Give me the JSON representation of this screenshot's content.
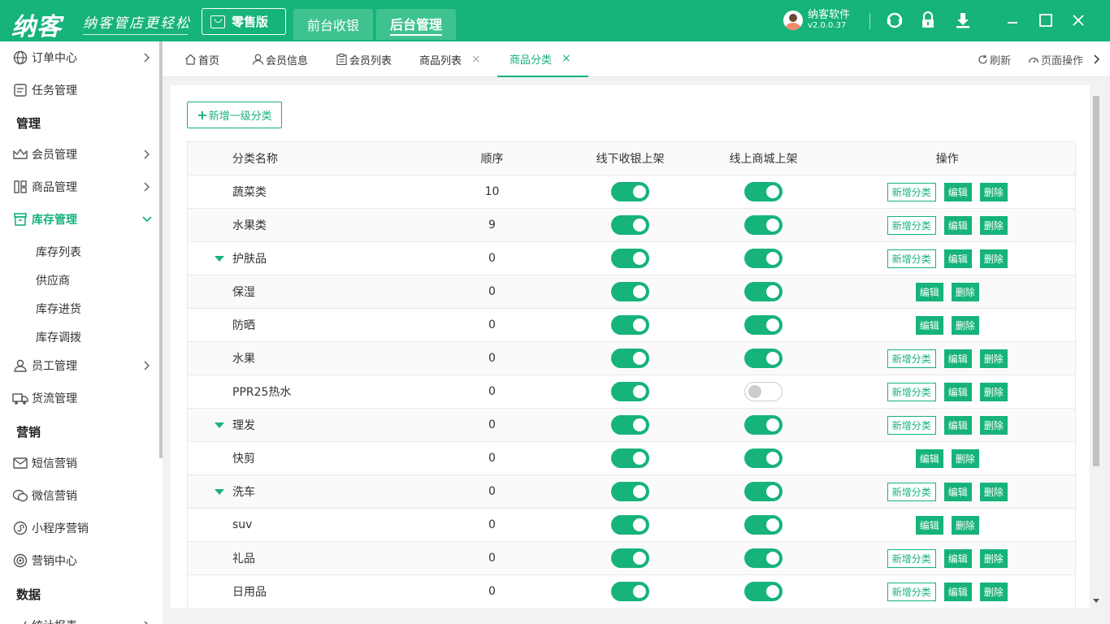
{
  "brand": {
    "logo": "纳客",
    "slogan": "纳客管店更轻松",
    "accent": "#16b37a"
  },
  "header": {
    "edition_label": "零售版",
    "tabs": [
      "前台收银",
      "后台管理"
    ],
    "user_name": "纳客软件",
    "version": "v2.0.0.37"
  },
  "sidebar": {
    "items": [
      {
        "label": "订单中心",
        "icon": "globe-icon",
        "has_arrow": true
      },
      {
        "label": "任务管理",
        "icon": "task-icon",
        "has_arrow": false
      },
      {
        "label": "会员管理",
        "icon": "crown-icon",
        "has_arrow": true
      },
      {
        "label": "商品管理",
        "icon": "goods-icon",
        "has_arrow": true
      },
      {
        "label": "库存管理",
        "icon": "inventory-icon",
        "has_arrow": true
      },
      {
        "label": "员工管理",
        "icon": "user-icon",
        "has_arrow": true
      },
      {
        "label": "货流管理",
        "icon": "truck-icon",
        "has_arrow": false
      },
      {
        "label": "短信营销",
        "icon": "mail-icon",
        "has_arrow": false
      },
      {
        "label": "微信营销",
        "icon": "wechat-icon",
        "has_arrow": false
      },
      {
        "label": "小程序营销",
        "icon": "miniprogram-icon",
        "has_arrow": false
      },
      {
        "label": "营销中心",
        "icon": "target-icon",
        "has_arrow": false
      },
      {
        "label": "统计报表",
        "icon": "chart-icon",
        "has_arrow": true
      }
    ],
    "groups": [
      "管理",
      "营销",
      "数据"
    ],
    "sub_items": [
      "库存列表",
      "供应商",
      "库存进货",
      "库存调拨"
    ]
  },
  "tabbar": {
    "tabs": [
      {
        "label": "首页",
        "icon": "home-icon"
      },
      {
        "label": "会员信息",
        "icon": "person-icon"
      },
      {
        "label": "会员列表",
        "icon": "clipboard-icon"
      },
      {
        "label": "商品列表",
        "closable": true
      },
      {
        "label": "商品分类",
        "closable": true,
        "active": true
      }
    ],
    "close_glyph": "×",
    "refresh": "刷新",
    "page_ops": "页面操作"
  },
  "toolbar": {
    "add_level1": "新增一级分类"
  },
  "table": {
    "headers": [
      "分类名称",
      "顺序",
      "线下收银上架",
      "线上商城上架",
      "操作"
    ],
    "op_labels": {
      "add": "新增分类",
      "edit": "编辑",
      "delete": "删除"
    },
    "rows": [
      {
        "name": "蔬菜类",
        "order": "10",
        "offline": true,
        "online": true,
        "can_add": true,
        "caret": false
      },
      {
        "name": "水果类",
        "order": "9",
        "offline": true,
        "online": true,
        "can_add": true,
        "caret": false
      },
      {
        "name": "护肤品",
        "order": "0",
        "offline": true,
        "online": true,
        "can_add": true,
        "caret": true
      },
      {
        "name": "保湿",
        "order": "0",
        "offline": true,
        "online": true,
        "can_add": false,
        "caret": false
      },
      {
        "name": "防晒",
        "order": "0",
        "offline": true,
        "online": true,
        "can_add": false,
        "caret": false
      },
      {
        "name": "水果",
        "order": "0",
        "offline": true,
        "online": true,
        "can_add": true,
        "caret": false
      },
      {
        "name": "PPR25热水",
        "order": "0",
        "offline": true,
        "online": false,
        "can_add": true,
        "caret": false
      },
      {
        "name": "理发",
        "order": "0",
        "offline": true,
        "online": true,
        "can_add": true,
        "caret": true
      },
      {
        "name": "快剪",
        "order": "0",
        "offline": true,
        "online": true,
        "can_add": false,
        "caret": false
      },
      {
        "name": "洗车",
        "order": "0",
        "offline": true,
        "online": true,
        "can_add": true,
        "caret": true
      },
      {
        "name": "suv",
        "order": "0",
        "offline": true,
        "online": true,
        "can_add": false,
        "caret": false
      },
      {
        "name": "礼品",
        "order": "0",
        "offline": true,
        "online": true,
        "can_add": true,
        "caret": false
      },
      {
        "name": "日用品",
        "order": "0",
        "offline": true,
        "online": true,
        "can_add": true,
        "caret": false
      }
    ]
  }
}
